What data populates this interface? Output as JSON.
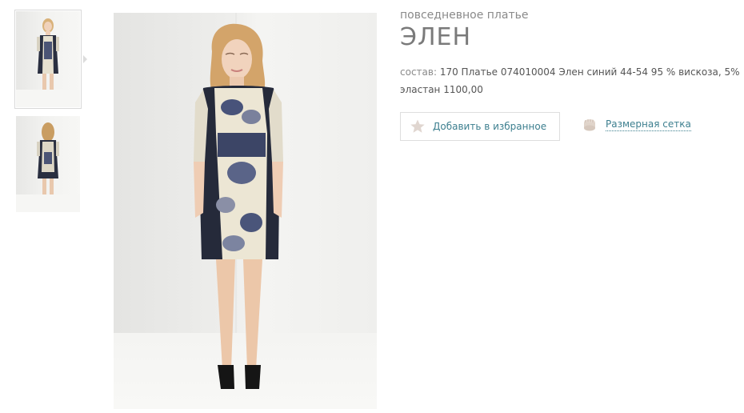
{
  "product": {
    "category": "повседневное платье",
    "title": "ЭЛЕН",
    "composition_label": "состав:",
    "composition_value": "170 Платье 074010004 Элен синий 44-54 95 % вискоза, 5% эластан 1100,00"
  },
  "actions": {
    "favorite_label": "Добавить в избранное",
    "favorite_icon": "star-icon",
    "size_chart_label": "Размерная сетка",
    "size_chart_icon": "measuring-tape-icon"
  },
  "gallery": {
    "thumbnails": [
      {
        "view": "front",
        "active": true
      },
      {
        "view": "back",
        "active": false
      }
    ]
  },
  "colors": {
    "link": "#3d7f8f",
    "icon_muted": "#e0d6d0",
    "title": "#7a7a7a"
  }
}
